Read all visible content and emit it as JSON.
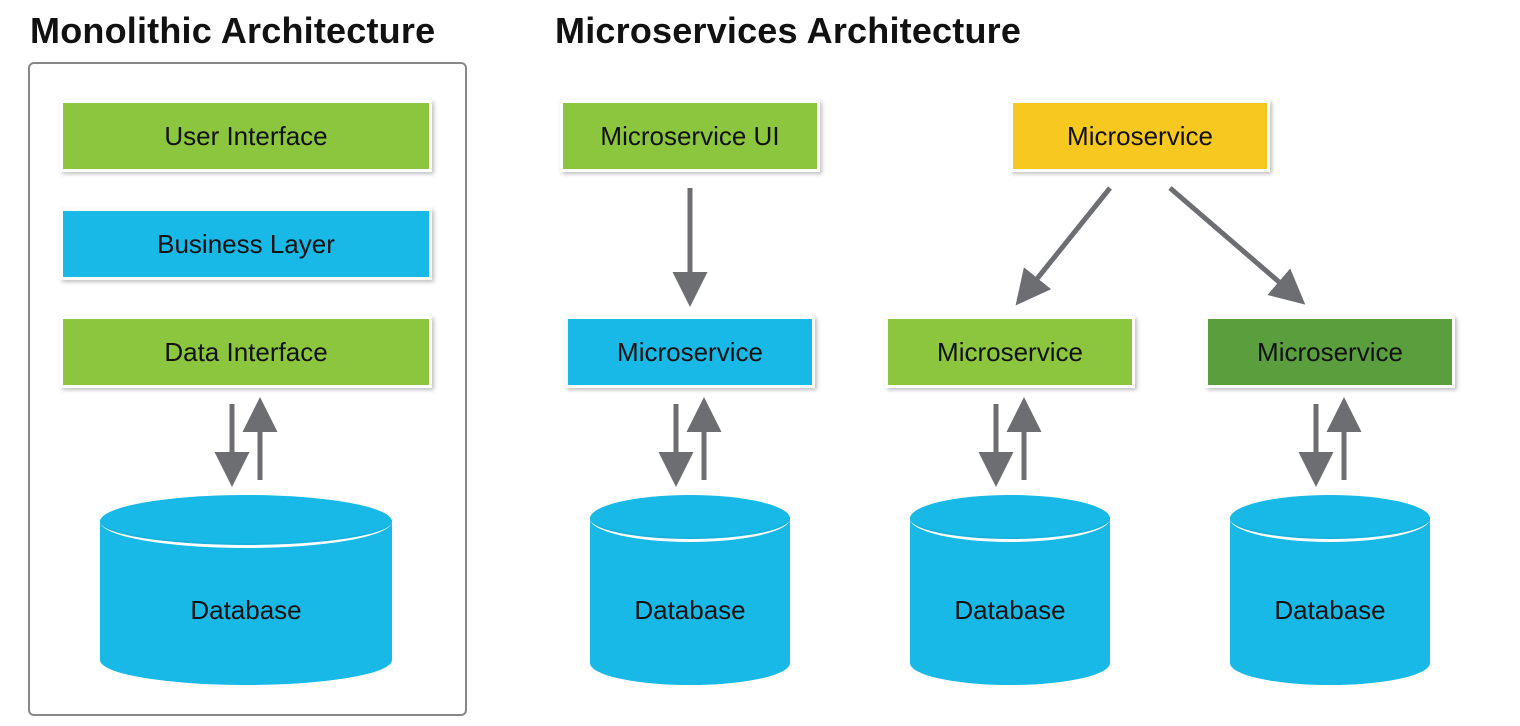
{
  "colors": {
    "lime": "#8cc63f",
    "cyan": "#18b9e6",
    "yellow": "#f7c820",
    "green": "#5a9e3e",
    "arrow": "#6d6e71",
    "frame": "#888888"
  },
  "monolithic": {
    "title": "Monolithic Architecture",
    "layers": [
      {
        "label": "User Interface",
        "color": "lime"
      },
      {
        "label": "Business Layer",
        "color": "cyan"
      },
      {
        "label": "Data Interface",
        "color": "lime"
      }
    ],
    "database_label": "Database"
  },
  "microservices": {
    "title": "Microservices Architecture",
    "top_row": [
      {
        "label": "Microservice UI",
        "color": "lime"
      },
      {
        "label": "Microservice",
        "color": "yellow"
      }
    ],
    "mid_row": [
      {
        "label": "Microservice",
        "color": "cyan"
      },
      {
        "label": "Microservice",
        "color": "lime"
      },
      {
        "label": "Microservice",
        "color": "green"
      }
    ],
    "database_label": "Database"
  }
}
